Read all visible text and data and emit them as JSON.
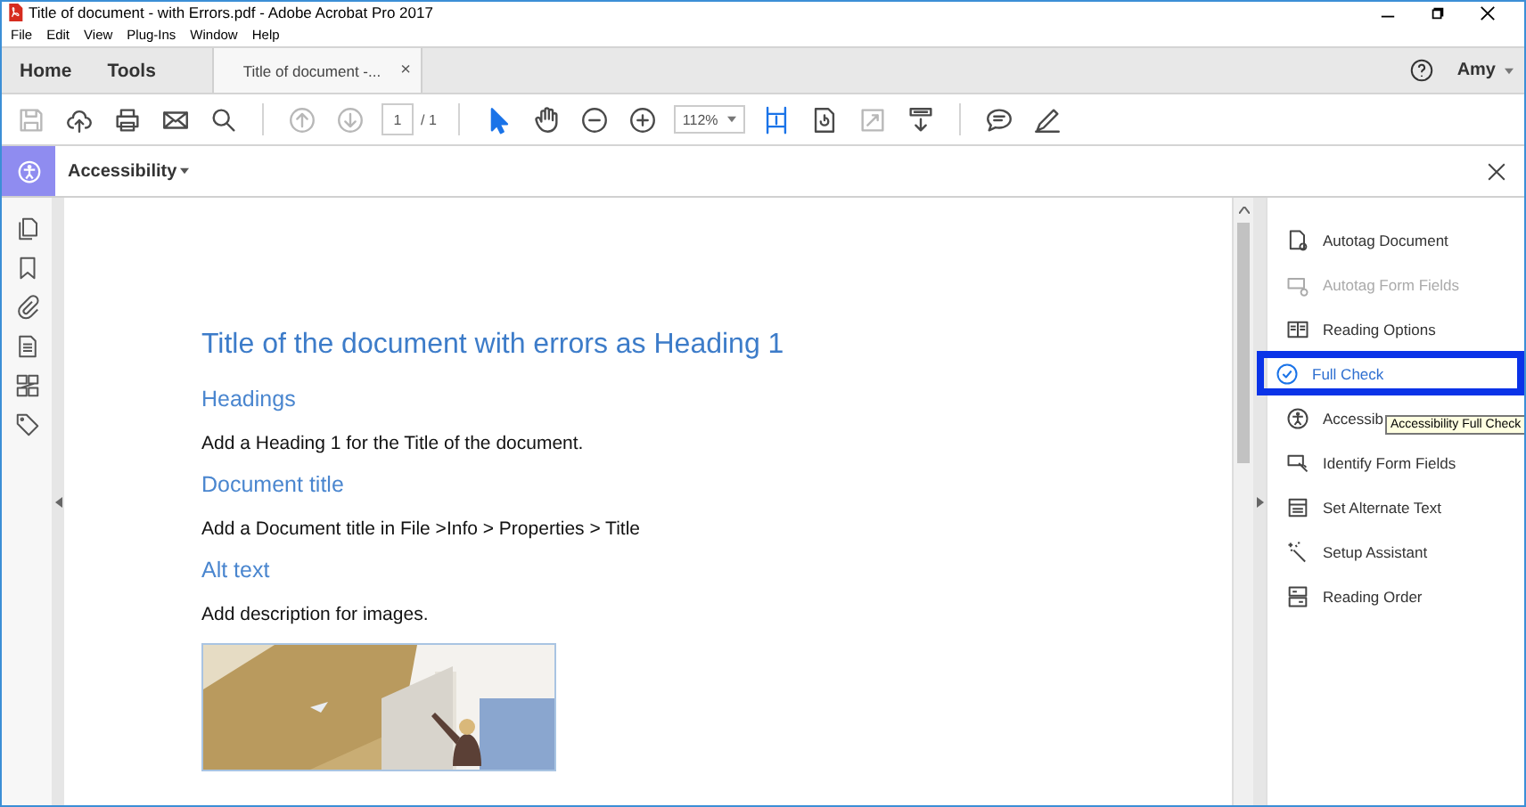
{
  "window": {
    "title": "Title of document - with Errors.pdf - Adobe Acrobat Pro 2017"
  },
  "menu": [
    "File",
    "Edit",
    "View",
    "Plug-Ins",
    "Window",
    "Help"
  ],
  "tabs": [
    {
      "label": "Home",
      "selected": false,
      "kind": "nav"
    },
    {
      "label": "Tools",
      "selected": false,
      "kind": "nav"
    },
    {
      "label": "Title of document -...",
      "selected": true,
      "kind": "doc",
      "close": "×"
    }
  ],
  "user": {
    "name": "Amy"
  },
  "toolbar": [
    {
      "kind": "save",
      "disabled": true,
      "active": false
    },
    {
      "kind": "upload",
      "disabled": false,
      "active": false
    },
    {
      "kind": "print",
      "disabled": false,
      "active": false
    },
    {
      "kind": "mail",
      "disabled": false,
      "active": false
    },
    {
      "kind": "search",
      "disabled": false,
      "active": false
    },
    {
      "kind": "separator"
    },
    {
      "kind": "up",
      "disabled": true,
      "active": false
    },
    {
      "kind": "down",
      "disabled": true,
      "active": false
    },
    {
      "kind": "page",
      "value": "1",
      "total": "/ 1"
    },
    {
      "kind": "separator"
    },
    {
      "kind": "select",
      "disabled": false,
      "active": true
    },
    {
      "kind": "hand",
      "disabled": false,
      "active": false
    },
    {
      "kind": "zoomout",
      "disabled": false,
      "active": false
    },
    {
      "kind": "zoomin",
      "disabled": false,
      "active": false
    },
    {
      "kind": "zoom",
      "value": "112%"
    },
    {
      "kind": "fit",
      "disabled": false,
      "active": true
    },
    {
      "kind": "rotate",
      "disabled": false,
      "active": false
    },
    {
      "kind": "fullscreen",
      "disabled": true,
      "active": false
    },
    {
      "kind": "scroll",
      "disabled": false,
      "active": false
    },
    {
      "kind": "separator"
    },
    {
      "kind": "comment",
      "disabled": false,
      "active": false
    },
    {
      "kind": "sign",
      "disabled": false,
      "active": false
    }
  ],
  "panel_header": {
    "title": "Accessibility"
  },
  "document": {
    "blocks": [
      {
        "kind": "title",
        "text": "Title of the document with errors as Heading 1"
      },
      {
        "kind": "heading",
        "text": "Headings"
      },
      {
        "kind": "body",
        "text": "Add a Heading 1 for the Title of the document."
      },
      {
        "kind": "heading",
        "text": "Document title"
      },
      {
        "kind": "body",
        "text": "Add a Document title in File >Info > Properties > Title"
      },
      {
        "kind": "heading",
        "text": "Alt text"
      },
      {
        "kind": "body",
        "text": "Add description for images."
      },
      {
        "kind": "picture"
      }
    ]
  },
  "tools": [
    {
      "label": "Autotag Document",
      "disabled": false,
      "selected": false
    },
    {
      "label": "Autotag Form Fields",
      "disabled": true,
      "selected": false
    },
    {
      "label": "Reading Options",
      "disabled": false,
      "selected": false
    },
    {
      "label": "Full Check",
      "disabled": false,
      "selected": true
    },
    {
      "label": "Accessib",
      "disabled": false,
      "selected": false
    },
    {
      "label": "Identify Form Fields",
      "disabled": false,
      "selected": false
    },
    {
      "label": "Set Alternate Text",
      "disabled": false,
      "selected": false
    },
    {
      "label": "Setup Assistant",
      "disabled": false,
      "selected": false
    },
    {
      "label": "Reading Order",
      "disabled": false,
      "selected": false
    }
  ],
  "tooltip": {
    "text": "Accessibility Full Check"
  }
}
